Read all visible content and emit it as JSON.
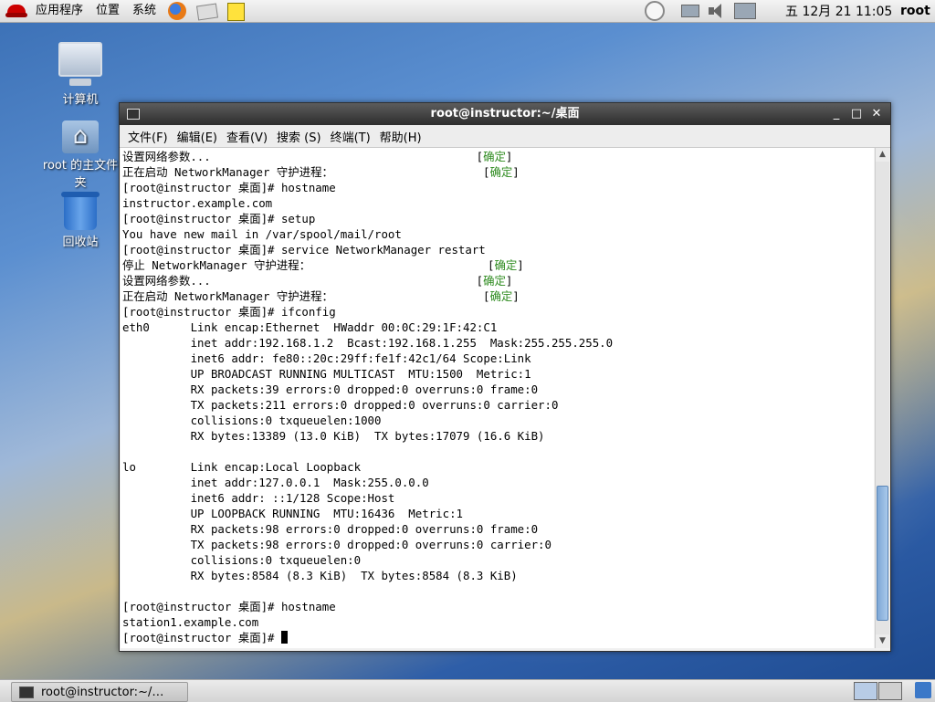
{
  "top_panel": {
    "menus": [
      "应用程序",
      "位置",
      "系统"
    ],
    "clock": "五 12月 21 11:05",
    "user": "root"
  },
  "desktop": {
    "icons": [
      {
        "label": "计算机",
        "icon": "computer-icon"
      },
      {
        "label": "root 的主文件夹",
        "icon": "home-folder-icon"
      },
      {
        "label": "回收站",
        "icon": "trash-icon"
      }
    ]
  },
  "window": {
    "title": "root@instructor:~/桌面",
    "menus": [
      "文件(F)",
      "编辑(E)",
      "查看(V)",
      "搜索 (S)",
      "终端(T)",
      "帮助(H)"
    ]
  },
  "terminal": {
    "lines": [
      [
        "设置网络参数...                                       [",
        "确定",
        "]"
      ],
      [
        "正在启动 NetworkManager 守护进程：                      [",
        "确定",
        "]"
      ],
      [
        "[root@instructor 桌面]# hostname"
      ],
      [
        "instructor.example.com"
      ],
      [
        "[root@instructor 桌面]# setup"
      ],
      [
        "You have new mail in /var/spool/mail/root"
      ],
      [
        "[root@instructor 桌面]# service NetworkManager restart"
      ],
      [
        "停止 NetworkManager 守护进程：                          [",
        "确定",
        "]"
      ],
      [
        "设置网络参数...                                       [",
        "确定",
        "]"
      ],
      [
        "正在启动 NetworkManager 守护进程：                      [",
        "确定",
        "]"
      ],
      [
        "[root@instructor 桌面]# ifconfig"
      ],
      [
        "eth0      Link encap:Ethernet  HWaddr 00:0C:29:1F:42:C1"
      ],
      [
        "          inet addr:192.168.1.2  Bcast:192.168.1.255  Mask:255.255.255.0"
      ],
      [
        "          inet6 addr: fe80::20c:29ff:fe1f:42c1/64 Scope:Link"
      ],
      [
        "          UP BROADCAST RUNNING MULTICAST  MTU:1500  Metric:1"
      ],
      [
        "          RX packets:39 errors:0 dropped:0 overruns:0 frame:0"
      ],
      [
        "          TX packets:211 errors:0 dropped:0 overruns:0 carrier:0"
      ],
      [
        "          collisions:0 txqueuelen:1000"
      ],
      [
        "          RX bytes:13389 (13.0 KiB)  TX bytes:17079 (16.6 KiB)"
      ],
      [
        ""
      ],
      [
        "lo        Link encap:Local Loopback"
      ],
      [
        "          inet addr:127.0.0.1  Mask:255.0.0.0"
      ],
      [
        "          inet6 addr: ::1/128 Scope:Host"
      ],
      [
        "          UP LOOPBACK RUNNING  MTU:16436  Metric:1"
      ],
      [
        "          RX packets:98 errors:0 dropped:0 overruns:0 frame:0"
      ],
      [
        "          TX packets:98 errors:0 dropped:0 overruns:0 carrier:0"
      ],
      [
        "          collisions:0 txqueuelen:0"
      ],
      [
        "          RX bytes:8584 (8.3 KiB)  TX bytes:8584 (8.3 KiB)"
      ],
      [
        ""
      ],
      [
        "[root@instructor 桌面]# hostname"
      ],
      [
        "station1.example.com"
      ],
      [
        "[root@instructor 桌面]# "
      ]
    ],
    "ok_color": "#2e8b1f"
  },
  "bottom_panel": {
    "task_label": "root@instructor:~/…"
  }
}
